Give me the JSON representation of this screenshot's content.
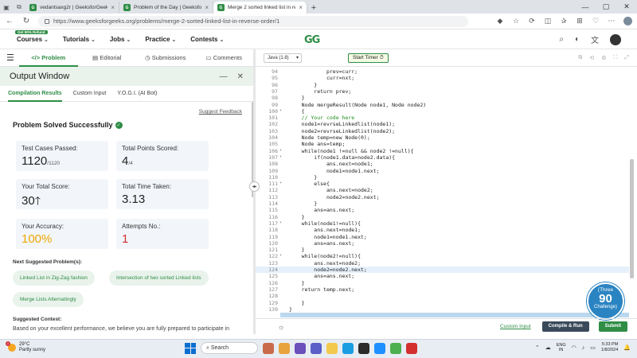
{
  "browser": {
    "tabs": [
      {
        "title": "vedantsaxg2r | GeeksforGeeks Pr...",
        "active": false
      },
      {
        "title": "Problem of the Day | GeeksforGe...",
        "active": false
      },
      {
        "title": "Merge 2 sorted linked list in reve...",
        "active": true
      }
    ],
    "url": "https://www.geeksforgeeks.org/problems/merge-2-sorted-linked-list-in-reverse-order/1"
  },
  "site": {
    "promo": "Get 90% Refund",
    "nav": [
      "Courses",
      "Tutorials",
      "Jobs",
      "Practice",
      "Contests"
    ],
    "logo": "GG"
  },
  "panel_tabs": [
    "Problem",
    "Editorial",
    "Submissions",
    "Comments"
  ],
  "output": {
    "title": "Output Window",
    "subtabs": [
      "Compilation Results",
      "Custom Input",
      "Y.O.G.I. (AI Bot)"
    ],
    "suggest_feedback": "Suggest Feedback",
    "status": "Problem Solved Successfully",
    "stats": {
      "tests_label": "Test Cases Passed:",
      "tests_value": "1120",
      "tests_total": "/1120",
      "points_label": "Total Points Scored:",
      "points_value": "4",
      "points_total": "/4",
      "score_label": "Your Total Score:",
      "score_value": "30",
      "time_label": "Total Time Taken:",
      "time_value": "3.13",
      "accuracy_label": "Your Accuracy:",
      "accuracy_value": "100%",
      "attempts_label": "Attempts No.:",
      "attempts_value": "1"
    },
    "next_heading": "Next Suggested Problem(s):",
    "next_problems": [
      "Linked List in Zig-Zag fashion",
      "Intersection of two sorted Linked lists",
      "Merge Lists Alternatingly"
    ],
    "contest_heading": "Suggested Contest:",
    "contest_text": "Based on your excellent performance, we believe you are fully prepared to participate in"
  },
  "editor": {
    "language": "Java (1.8)",
    "timer": "Start Timer",
    "lines": [
      {
        "n": "94",
        "t": "            prev=curr;"
      },
      {
        "n": "95",
        "t": "            curr=nxt;"
      },
      {
        "n": "96",
        "t": "        }"
      },
      {
        "n": "97",
        "t": "        return prev;"
      },
      {
        "n": "98",
        "t": "    }"
      },
      {
        "n": "99",
        "t": "    Node mergeResult(Node node1, Node node2)"
      },
      {
        "n": "100",
        "t": "    {",
        "f": true
      },
      {
        "n": "101",
        "t": "    // Your code here"
      },
      {
        "n": "102",
        "t": "    node1=revrseLinkedlist(node1);"
      },
      {
        "n": "103",
        "t": "    node2=revrseLinkedlist(node2);"
      },
      {
        "n": "104",
        "t": "    Node temp=new Node(0);"
      },
      {
        "n": "105",
        "t": "    Node ans=temp;"
      },
      {
        "n": "106",
        "t": "    while(node1 !=null && node2 !=null){",
        "f": true
      },
      {
        "n": "107",
        "t": "        if(node1.data>node2.data){",
        "f": true
      },
      {
        "n": "108",
        "t": "            ans.next=node1;"
      },
      {
        "n": "109",
        "t": "            node1=node1.next;"
      },
      {
        "n": "110",
        "t": "        }"
      },
      {
        "n": "111",
        "t": "        else{",
        "f": true
      },
      {
        "n": "112",
        "t": "            ans.next=node2;"
      },
      {
        "n": "113",
        "t": "            node2=node2.next;"
      },
      {
        "n": "114",
        "t": "        }"
      },
      {
        "n": "115",
        "t": "        ans=ans.next;"
      },
      {
        "n": "116",
        "t": "    }"
      },
      {
        "n": "117",
        "t": "    while(node1!=null){",
        "f": true
      },
      {
        "n": "118",
        "t": "        ans.next=node1;"
      },
      {
        "n": "119",
        "t": "        node1=node1.next;"
      },
      {
        "n": "120",
        "t": "        ans=ans.next;"
      },
      {
        "n": "121",
        "t": "    }"
      },
      {
        "n": "122",
        "t": "    while(node2!=null){",
        "f": true
      },
      {
        "n": "123",
        "t": "        ans.next=node2;"
      },
      {
        "n": "124",
        "t": "        node2=node2.next;",
        "hl": true
      },
      {
        "n": "125",
        "t": "        ans=ans.next;"
      },
      {
        "n": "126",
        "t": "    }"
      },
      {
        "n": "127",
        "t": "    return temp.next;"
      },
      {
        "n": "128",
        "t": ""
      },
      {
        "n": "129",
        "t": "    }"
      },
      {
        "n": "130",
        "t": "}"
      },
      {
        "n": "131",
        "t": ""
      }
    ],
    "custom_input": "Custom Input",
    "compile_run": "Compile & Run",
    "submit": "Submit"
  },
  "challenge": {
    "line1": "(Three",
    "number": "90",
    "line2": "Challenge)"
  },
  "taskbar": {
    "temp": "29°C",
    "weather": "Partly sunny",
    "notif": "1",
    "search": "Search",
    "lang": "ENG",
    "region": "IN",
    "time": "5:33 PM",
    "date": "1/8/2024"
  }
}
